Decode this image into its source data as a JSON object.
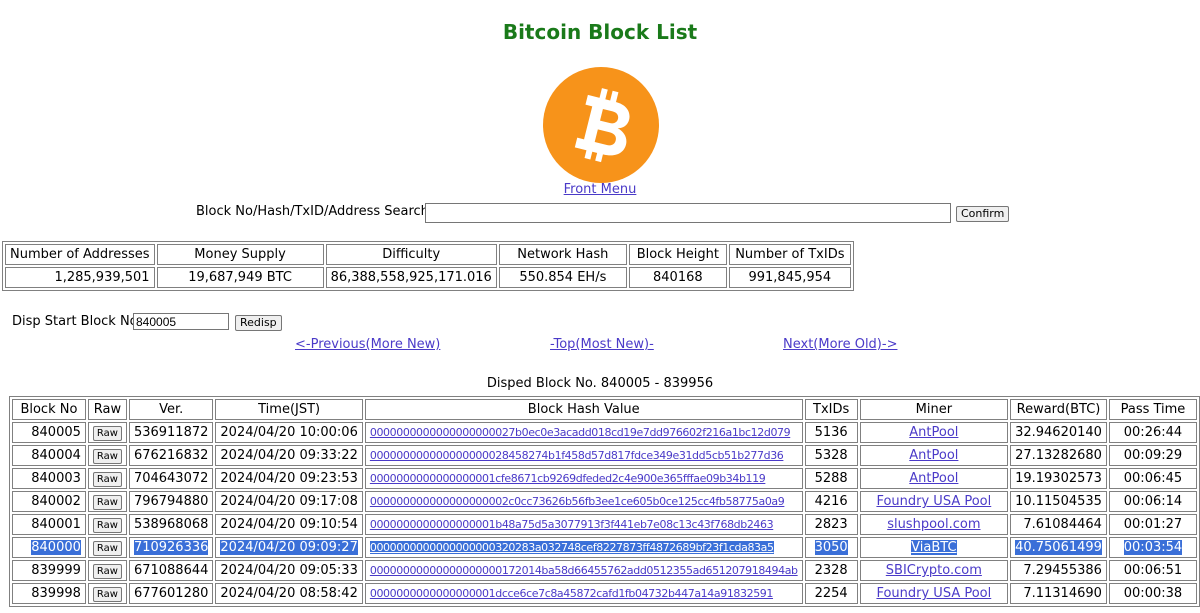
{
  "page": {
    "title": "Bitcoin Block List",
    "logo_icon": "bitcoin-logo-icon",
    "front_menu": "Front Menu",
    "brand_color": "#f7931a",
    "title_color": "#1a7a1a",
    "link_color": "#4a3ac8",
    "selection_color": "#3a6fd8"
  },
  "search": {
    "label": "Block No/Hash/TxID/Address Search",
    "value": "",
    "confirm": "Confirm"
  },
  "stats": {
    "headers": [
      "Number of Addresses",
      "Money Supply",
      "Difficulty",
      "Network Hash",
      "Block Height",
      "Number of TxIDs"
    ],
    "values": [
      "1,285,939,501",
      "19,687,949 BTC",
      "86,388,558,925,171.016",
      "550.854 EH/s",
      "840168",
      "991,845,954"
    ]
  },
  "disp": {
    "label": "Disp Start Block No",
    "value": "840005",
    "redisp": "Redisp"
  },
  "nav": {
    "previous": "<-Previous(More New)",
    "top": "-Top(Most New)-",
    "next": "Next(More Old)->"
  },
  "disped": "Disped Block No. 840005 - 839956",
  "blocks": {
    "headers": [
      "Block No",
      "Raw",
      "Ver.",
      "Time(JST)",
      "Block Hash Value",
      "TxIDs",
      "Miner",
      "Reward(BTC)",
      "Pass Time"
    ],
    "raw_label": "Raw",
    "rows": [
      {
        "no": "840005",
        "ver": "536911872",
        "time": "2024/04/20 10:00:06",
        "hash": "0000000000000000000027b0ec0e3acadd018cd19e7dd976602f216a1bc12d079",
        "txids": "5136",
        "miner": "AntPool",
        "reward": "32.94620140",
        "pass": "00:26:44",
        "selected": false
      },
      {
        "no": "840004",
        "ver": "676216832",
        "time": "2024/04/20 09:33:22",
        "hash": "000000000000000000028458274b1f458d57d817fdce349e31dd5cb51b277d36",
        "txids": "5328",
        "miner": "AntPool",
        "reward": "27.13282680",
        "pass": "00:09:29",
        "selected": false
      },
      {
        "no": "840003",
        "ver": "704643072",
        "time": "2024/04/20 09:23:53",
        "hash": "0000000000000000001cfe8671cb9269dfeded2c4e900e365fffae09b34b119",
        "txids": "5288",
        "miner": "AntPool",
        "reward": "19.19302573",
        "pass": "00:06:45",
        "selected": false
      },
      {
        "no": "840002",
        "ver": "796794880",
        "time": "2024/04/20 09:17:08",
        "hash": "000000000000000000002c0cc73626b56fb3ee1ce605b0ce125cc4fb58775a0a9",
        "txids": "4216",
        "miner": "Foundry USA Pool",
        "reward": "10.11504535",
        "pass": "00:06:14",
        "selected": false
      },
      {
        "no": "840001",
        "ver": "538968068",
        "time": "2024/04/20 09:10:54",
        "hash": "0000000000000000001b48a75d5a3077913f3f441eb7e08c13c43f768db2463",
        "txids": "2823",
        "miner": "slushpool.com",
        "reward": "7.61084464",
        "pass": "00:01:27",
        "selected": false
      },
      {
        "no": "840000",
        "ver": "710926336",
        "time": "2024/04/20 09:09:27",
        "hash": "0000000000000000000320283a032748cef8227873ff4872689bf23f1cda83a5",
        "txids": "3050",
        "miner": "ViaBTC",
        "reward": "40.75061499",
        "pass": "00:03:54",
        "selected": true
      },
      {
        "no": "839999",
        "ver": "671088644",
        "time": "2024/04/20 09:05:33",
        "hash": "00000000000000000000172014ba58d66455762add0512355ad651207918494ab",
        "txids": "2328",
        "miner": "SBICrypto.com",
        "reward": "7.29455386",
        "pass": "00:06:51",
        "selected": false
      },
      {
        "no": "839998",
        "ver": "677601280",
        "time": "2024/04/20 08:58:42",
        "hash": "0000000000000000001dcce6ce7c8a45872cafd1fb04732b447a14a91832591",
        "txids": "2254",
        "miner": "Foundry USA Pool",
        "reward": "7.11314690",
        "pass": "00:00:38",
        "selected": false
      }
    ]
  }
}
